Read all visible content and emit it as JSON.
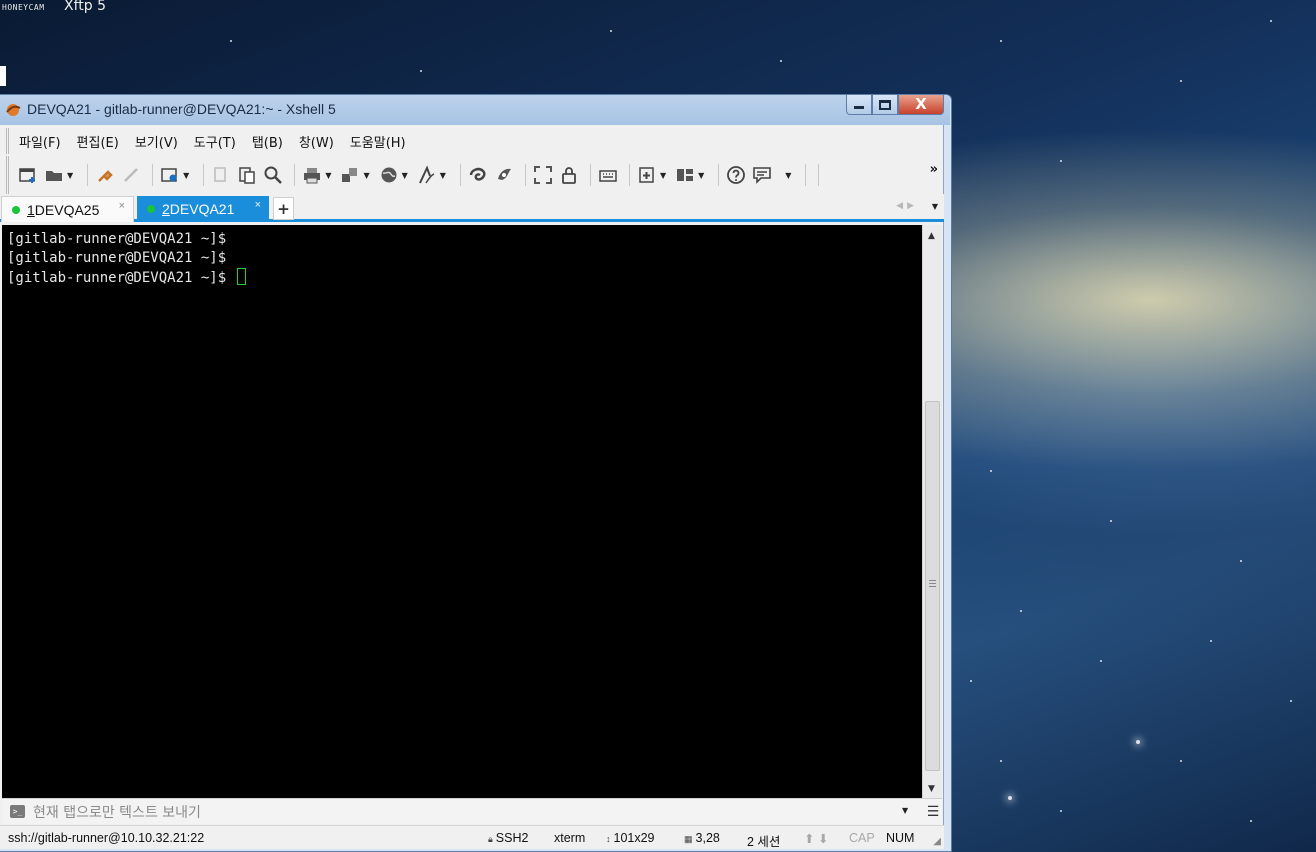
{
  "desktop": {
    "watermark": "HONEYCAM",
    "title": "Xftp 5"
  },
  "window": {
    "title": "DEVQA21 - gitlab-runner@DEVQA21:~ - Xshell 5",
    "close_glyph": "X"
  },
  "menu": {
    "items": [
      "파일(F)",
      "편집(E)",
      "보기(V)",
      "도구(T)",
      "탭(B)",
      "창(W)",
      "도움말(H)"
    ]
  },
  "toolbar": {
    "more_glyph": "»"
  },
  "tabs": [
    {
      "number": "1",
      "label": " DEVQA25",
      "active": false
    },
    {
      "number": "2",
      "label": " DEVQA21",
      "active": true
    }
  ],
  "tab_controls": {
    "add_label": "+",
    "close_glyph": "×"
  },
  "terminal": {
    "lines": [
      "[gitlab-runner@DEVQA21 ~]$",
      "[gitlab-runner@DEVQA21 ~]$",
      "[gitlab-runner@DEVQA21 ~]$ "
    ]
  },
  "sendbar": {
    "placeholder": "현재 탭으로만 텍스트 보내기"
  },
  "status": {
    "connection": "ssh://gitlab-runner@10.10.32.21:22",
    "protocol": "SSH2",
    "terminal_type": "xterm",
    "size": "101x29",
    "cursor_pos": "3,28",
    "sessions": "2 세션",
    "cap": "CAP",
    "num": "NUM"
  },
  "colors": {
    "tab_active": "#1a8ddb",
    "status_dot": "#18c43a",
    "cursor": "#20d23a",
    "terminal_bg": "#000000"
  }
}
